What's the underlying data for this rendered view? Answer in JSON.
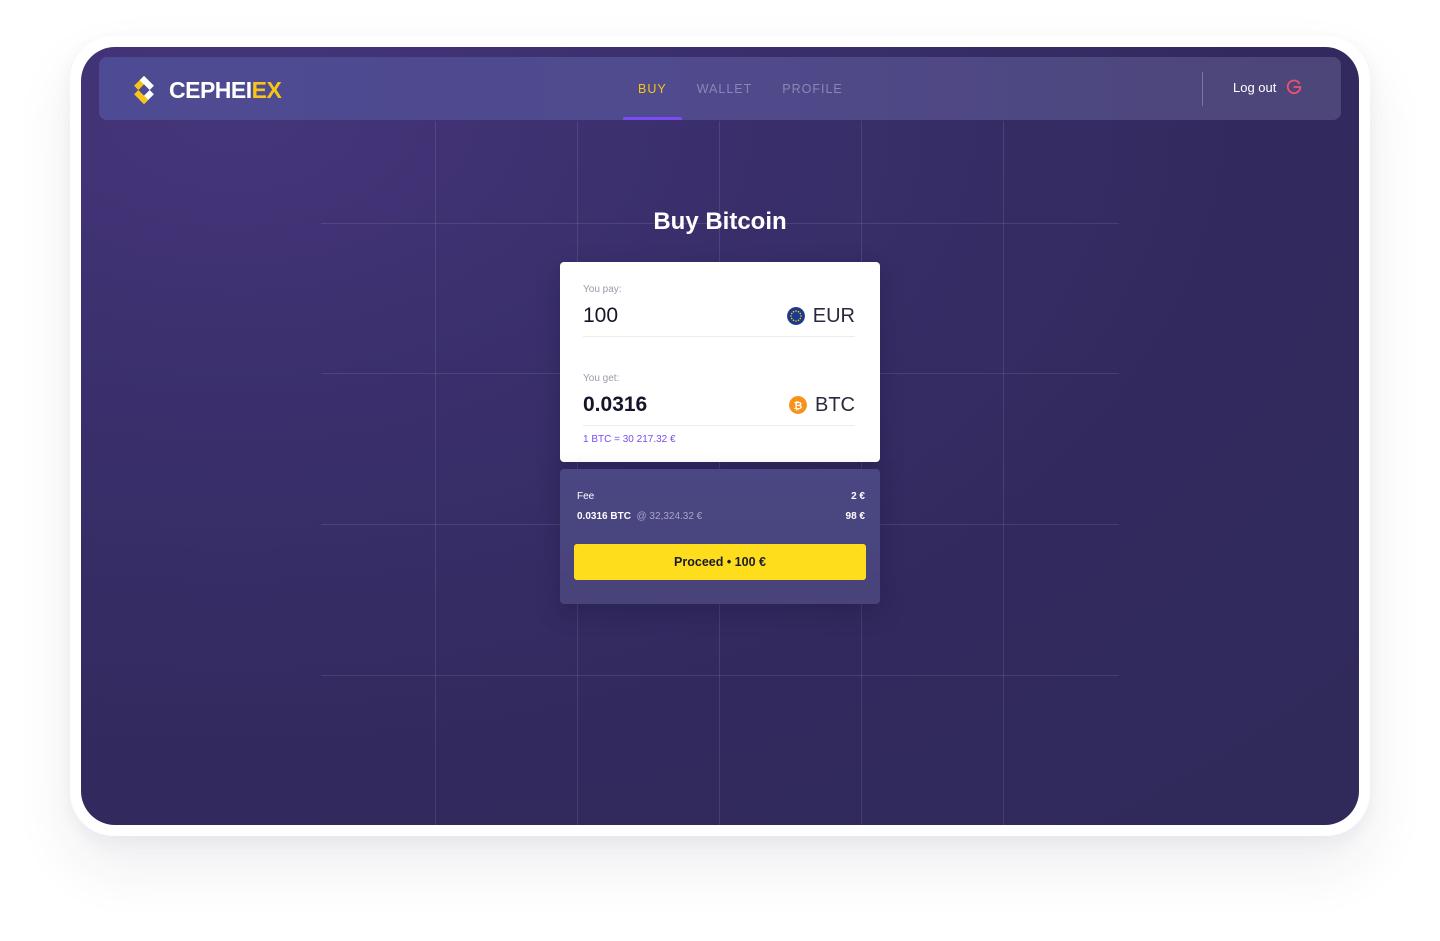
{
  "brand": {
    "name_main": "CEPHEI",
    "name_accent": "EX",
    "accent_color": "#f7c515"
  },
  "nav": {
    "tabs": [
      {
        "label": "BUY",
        "active": true
      },
      {
        "label": "WALLET",
        "active": false
      },
      {
        "label": "PROFILE",
        "active": false
      }
    ],
    "logout_label": "Log out"
  },
  "page": {
    "title": "Buy Bitcoin"
  },
  "exchange": {
    "pay": {
      "label": "You pay:",
      "value": "100",
      "currency": "EUR",
      "icon": "eu-flag-icon"
    },
    "get": {
      "label": "You get:",
      "value": "0.0316",
      "currency": "BTC",
      "icon": "bitcoin-icon"
    },
    "rate": "1 BTC = 30 217.32 €"
  },
  "summary": {
    "fee_label": "Fee",
    "fee_value": "2 €",
    "amount_btc": "0.0316 BTC",
    "amount_rate": "@ 32,324.32 €",
    "amount_value": "98 €",
    "proceed_label": "Proceed • 100 €"
  },
  "colors": {
    "primary_button": "#fedd1d",
    "tab_indicator": "#7b4cf2",
    "logout_icon": "#f0506e"
  }
}
